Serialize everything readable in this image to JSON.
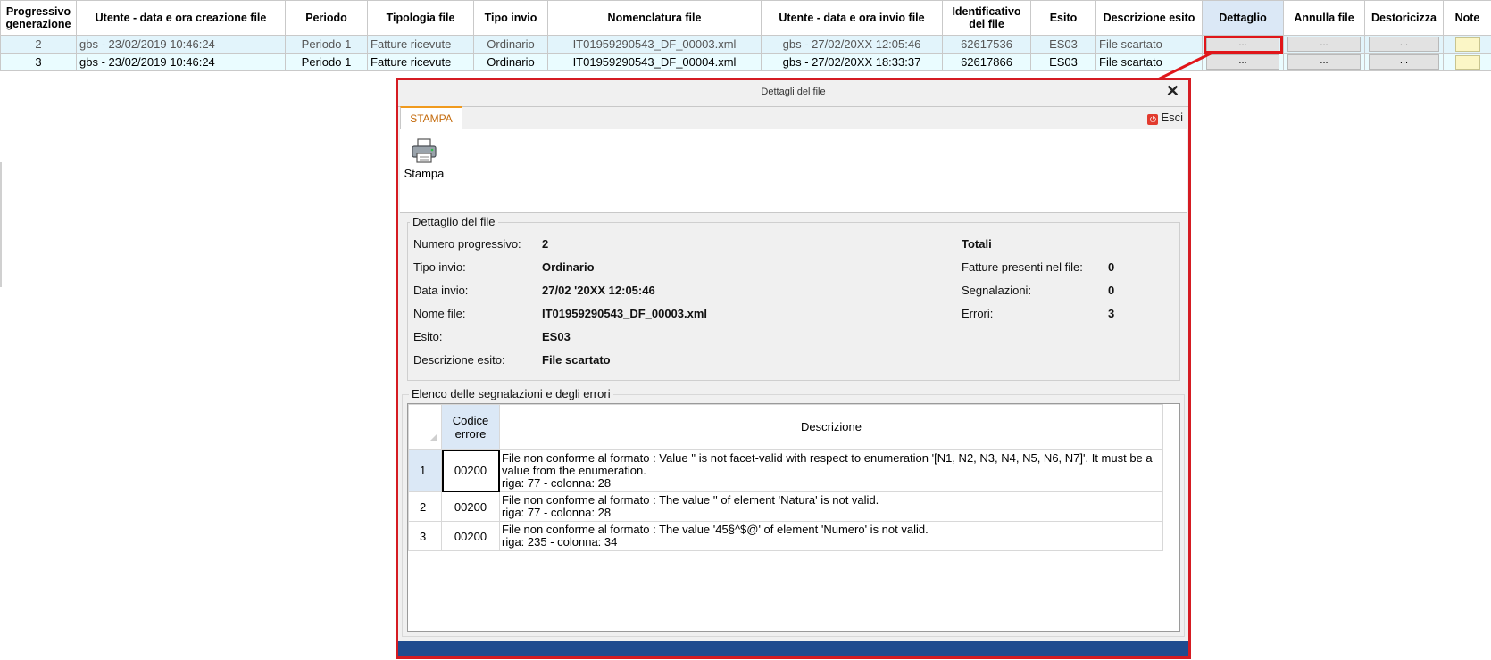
{
  "grid": {
    "headers": [
      "Progressivo generazione",
      "Utente - data e ora creazione file",
      "Periodo",
      "Tipologia file",
      "Tipo invio",
      "Nomenclatura file",
      "Utente - data e ora invio file",
      "Identificativo del file",
      "Esito",
      "Descrizione esito",
      "Dettaglio",
      "Annulla file",
      "Destoricizza",
      "Note"
    ],
    "rows": [
      {
        "prog": "2",
        "utente_creazione": "gbs  - 23/02/2019 10:46:24",
        "periodo": "Periodo 1",
        "tipologia": "Fatture ricevute",
        "tipo_invio": "Ordinario",
        "nomenclatura": "IT01959290543_DF_00003.xml",
        "utente_invio": "gbs  - 27/02/20XX 12:05:46",
        "identificativo": "62617536",
        "esito": "ES03",
        "descrizione": "File scartato",
        "dettaglio": "...",
        "annulla": "...",
        "destoricizza": "..."
      },
      {
        "prog": "3",
        "utente_creazione": "gbs  - 23/02/2019 10:46:24",
        "periodo": "Periodo 1",
        "tipologia": "Fatture ricevute",
        "tipo_invio": "Ordinario",
        "nomenclatura": "IT01959290543_DF_00004.xml",
        "utente_invio": "gbs  - 27/02/20XX 18:33:37",
        "identificativo": "62617866",
        "esito": "ES03",
        "descrizione": "File scartato",
        "dettaglio": "...",
        "annulla": "...",
        "destoricizza": "..."
      }
    ]
  },
  "dialog": {
    "title": "Dettagli del file",
    "close_icon": "close-icon",
    "tab_label": "STAMPA",
    "esci_label": "Esci",
    "stampa_label": "Stampa",
    "dettaglio": {
      "title": "Dettaglio del file",
      "fields": [
        {
          "label": "Numero progressivo:",
          "value": "2"
        },
        {
          "label": "Tipo invio:",
          "value": "Ordinario"
        },
        {
          "label": "Data invio:",
          "value": "27/02 '20XX 12:05:46"
        },
        {
          "label": "Nome file:",
          "value": "IT01959290543_DF_00003.xml"
        },
        {
          "label": "Esito:",
          "value": "ES03"
        },
        {
          "label": "Descrizione esito:",
          "value": "File scartato"
        }
      ],
      "totali_title": "Totali",
      "totali": [
        {
          "label": "Fatture presenti nel file:",
          "value": "0"
        },
        {
          "label": "Segnalazioni:",
          "value": "0"
        },
        {
          "label": "Errori:",
          "value": "3"
        }
      ]
    },
    "errori": {
      "title": "Elenco delle segnalazioni e degli errori",
      "col_codice": "Codice errore",
      "col_descrizione": "Descrizione",
      "rows": [
        {
          "n": "1",
          "codice": "00200",
          "descrizione": "File non conforme al formato : Value '' is not facet-valid with respect to enumeration '[N1, N2, N3, N4, N5, N6, N7]'. It must be a value from the enumeration.",
          "posizione": "riga: 77 - colonna: 28"
        },
        {
          "n": "2",
          "codice": "00200",
          "descrizione": "File non conforme al formato : The value '' of element 'Natura' is not valid.",
          "posizione": "riga: 77 - colonna: 28"
        },
        {
          "n": "3",
          "codice": "00200",
          "descrizione": "File non conforme al formato : The value '45§^$@' of element 'Numero' is not valid.",
          "posizione": "riga: 235 - colonna: 34"
        }
      ]
    }
  },
  "colors": {
    "highlight": "#e0161a",
    "selected_header": "#dbe8f6",
    "accent_tab": "#f09a1e",
    "bottom_bar": "#1f4b8f"
  }
}
